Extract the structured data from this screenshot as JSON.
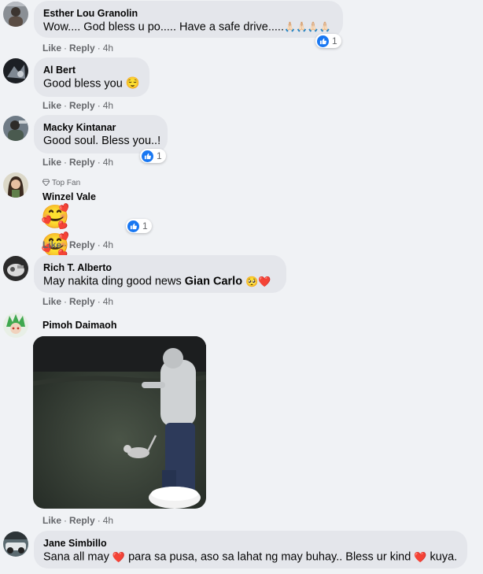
{
  "comments": [
    {
      "author": "Esther Lou Granolin",
      "text": "Wow.... God bless u po..... Have a safe drive.....",
      "emoji_tail": "🙏🏻🙏🏻🙏🏻🙏🏻",
      "reactions": "1",
      "like": "Like",
      "reply": "Reply",
      "time": "4h"
    },
    {
      "author": "Al Bert",
      "text": "Good bless you",
      "emoji_tail": "😌",
      "like": "Like",
      "reply": "Reply",
      "time": "4h"
    },
    {
      "author": "Macky Kintanar",
      "text": "Good soul. Bless you..!",
      "reactions": "1",
      "like": "Like",
      "reply": "Reply",
      "time": "4h"
    },
    {
      "author": "Winzel Vale",
      "badge": "Top Fan",
      "emoji_only": "🥰🥰🥰",
      "reactions": "1",
      "like": "Like",
      "reply": "Reply",
      "time": "4h"
    },
    {
      "author": "Rich T. Alberto",
      "text_before": "May nakita ding good news ",
      "mention": "Gian Carlo",
      "emoji_tail": "🥺❤️",
      "like": "Like",
      "reply": "Reply",
      "time": "4h"
    },
    {
      "author": "Pimoh Daimaoh",
      "like": "Like",
      "reply": "Reply",
      "time": "4h"
    },
    {
      "author": "Jane Simbillo",
      "text_a": "Sana all may ",
      "text_b": " para sa pusa, aso sa lahat ng may buhay.. Bless ur kind ",
      "text_c": " kuya.",
      "heart": "❤️"
    }
  ],
  "dot": "·",
  "colors": {
    "bubble": "#e4e6eb",
    "bg": "#f0f2f5",
    "like_blue": "#1877f2",
    "meta": "#65676b"
  }
}
